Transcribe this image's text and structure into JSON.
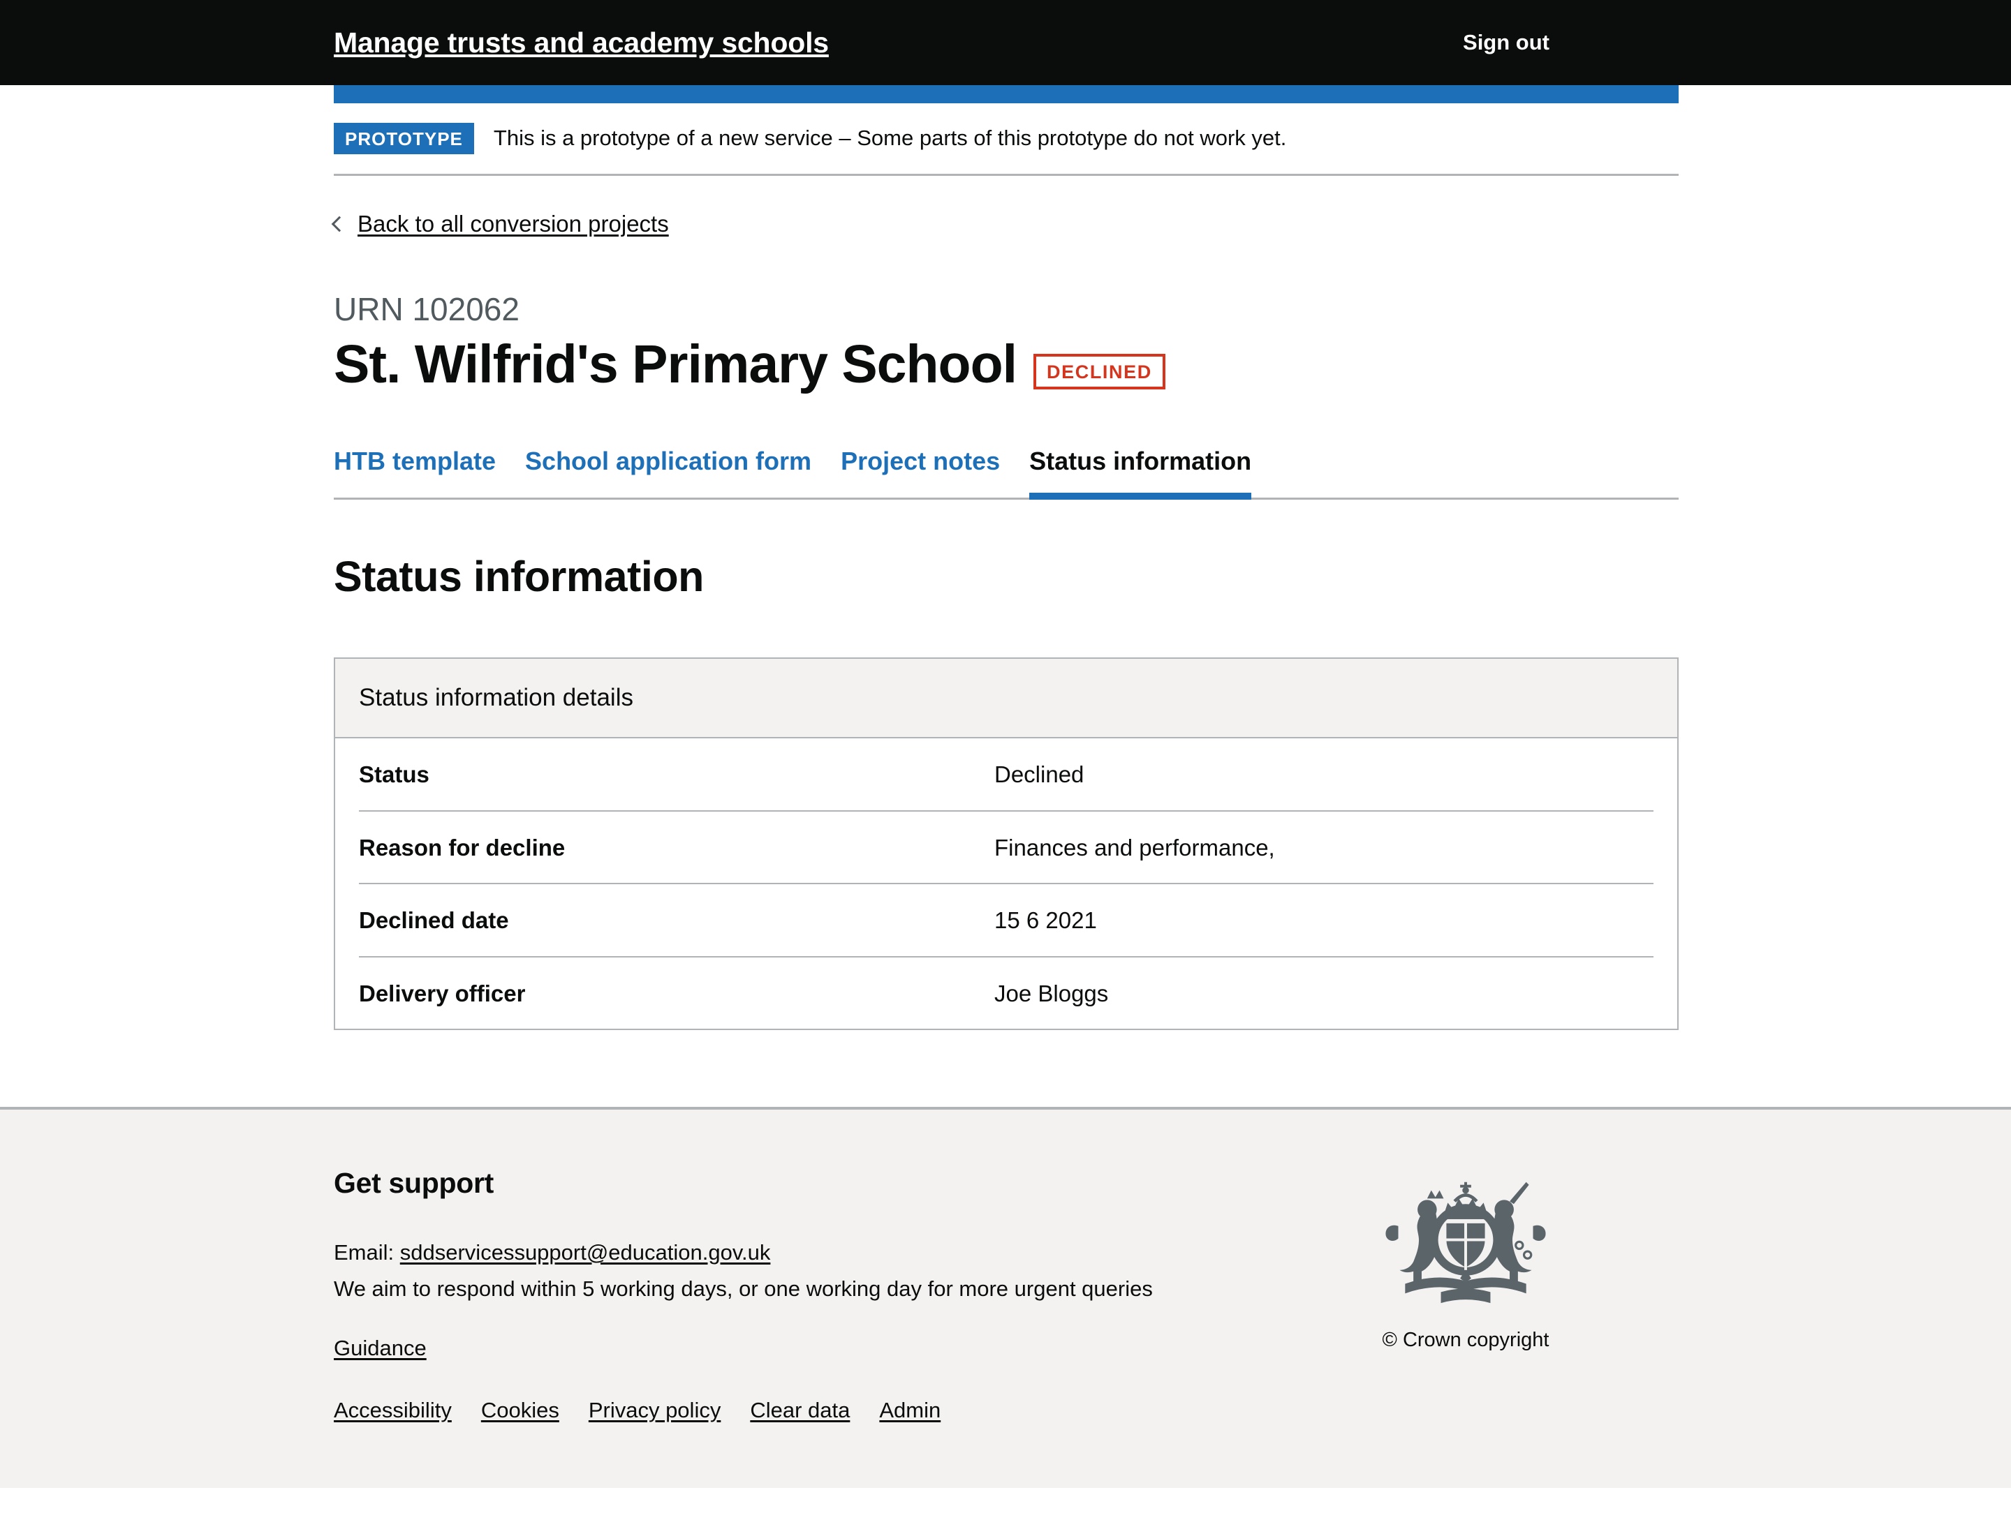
{
  "header": {
    "service_name": "Manage trusts and academy schools",
    "sign_out_label": "Sign out"
  },
  "phase_banner": {
    "tag": "PROTOTYPE",
    "text": "This is a prototype of a new service – Some parts of this prototype do not work yet."
  },
  "back_link": {
    "label": "Back to all conversion projects",
    "icon": "chevron-left-icon"
  },
  "page": {
    "urn_caption": "URN 102062",
    "title": "St. Wilfrid's Primary School",
    "status_tag": "DECLINED",
    "status_tag_color": "#d4351c"
  },
  "tabs": [
    {
      "label": "HTB template",
      "selected": false
    },
    {
      "label": "School application form",
      "selected": false
    },
    {
      "label": "Project notes",
      "selected": false
    },
    {
      "label": "Status information",
      "selected": true
    }
  ],
  "main": {
    "section_heading": "Status information",
    "card_title": "Status information details",
    "rows": [
      {
        "key": "Status",
        "value": "Declined"
      },
      {
        "key": "Reason for decline",
        "value": "Finances and performance,"
      },
      {
        "key": "Declined date",
        "value": "15 6 2021"
      },
      {
        "key": "Delivery officer",
        "value": "Joe Bloggs"
      }
    ]
  },
  "footer": {
    "heading": "Get support",
    "email_prefix": "Email:",
    "email": "sddservicessupport@education.gov.uk",
    "response_text": "We aim to respond within 5 working days, or one working day for more urgent queries",
    "guidance_label": "Guidance",
    "meta_links": [
      "Accessibility",
      "Cookies",
      "Privacy policy",
      "Clear data",
      "Admin"
    ],
    "crown_copyright": "© Crown copyright",
    "crown_logo_icon": "royal-coat-of-arms-icon"
  },
  "theme": {
    "brand_blue": "#1d70b8",
    "black": "#0b0c0c",
    "grey_border": "#b1b4b6",
    "grey_bg": "#f3f2f1",
    "red": "#d4351c"
  }
}
